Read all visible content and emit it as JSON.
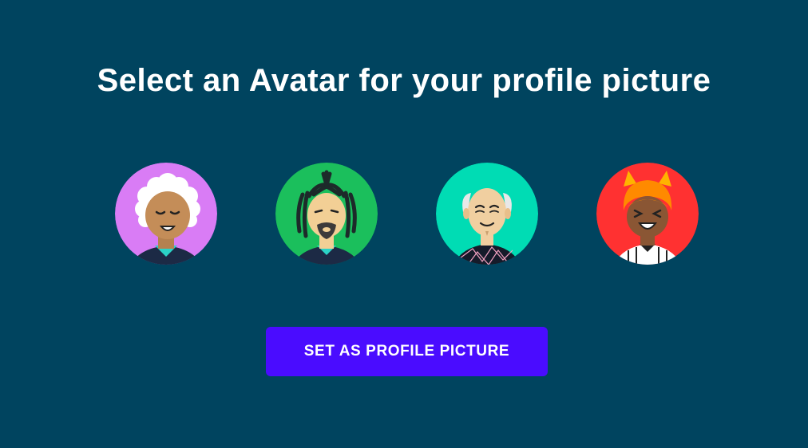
{
  "page": {
    "title": "Select an Avatar for your profile picture"
  },
  "avatars": [
    {
      "icon": "curly-white-hair-avatar-icon",
      "bg": "#d97cf5"
    },
    {
      "icon": "dreadlocks-avatar-icon",
      "bg": "#1bbf5c"
    },
    {
      "icon": "bald-old-man-avatar-icon",
      "bg": "#00dcb4"
    },
    {
      "icon": "devil-horns-avatar-icon",
      "bg": "#ff3131"
    }
  ],
  "actions": {
    "set_profile_label": "SET AS PROFILE PICTURE"
  },
  "colors": {
    "background": "#00445f",
    "button": "#4a0cff",
    "text": "#ffffff"
  }
}
